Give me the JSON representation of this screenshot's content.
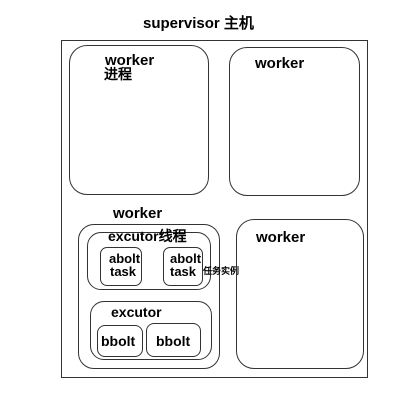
{
  "title": "supervisor 主机",
  "worker_top_left": {
    "label": "worker",
    "sublabel": "进程"
  },
  "worker_top_right": {
    "label": "worker"
  },
  "worker_bottom_left": {
    "label": "worker",
    "executor_thread": {
      "label": "excutor线程",
      "task_a": {
        "name": "abolt",
        "type": "task"
      },
      "task_b": {
        "name": "abolt",
        "type": "task"
      },
      "task_instance_note": "任务实例"
    },
    "executor": {
      "label": "excutor",
      "bolt_a": "bbolt",
      "bolt_b": "bbolt"
    }
  },
  "worker_bottom_right": {
    "label": "worker"
  }
}
